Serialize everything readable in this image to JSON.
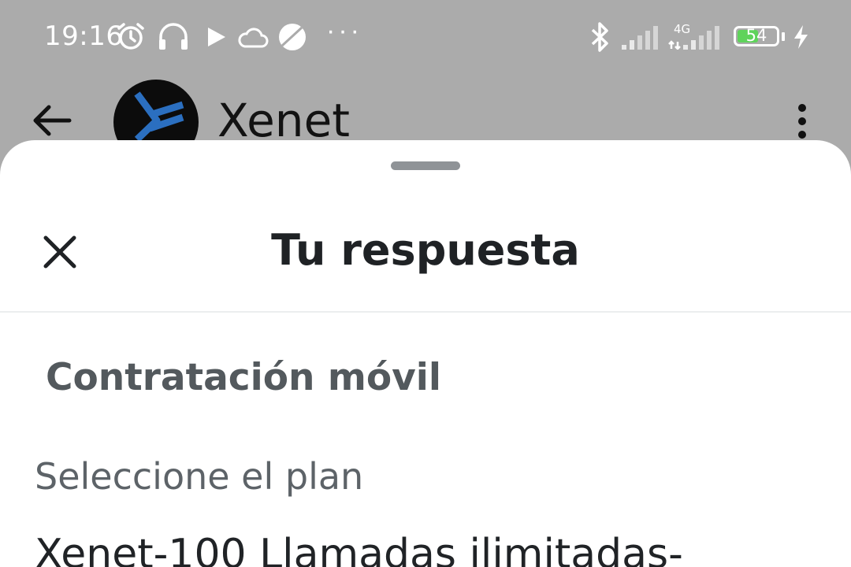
{
  "status_bar": {
    "time": "19:16",
    "notification_icons": [
      "alarm-icon",
      "headphones-icon",
      "play-icon",
      "cloud-icon",
      "planet-icon",
      "more-notifications-icon"
    ],
    "system_icons": [
      "bluetooth-icon",
      "signal-icon",
      "4g-signal-icon",
      "battery-icon",
      "charging-icon"
    ],
    "network_label": "4G",
    "battery_level": "54",
    "battery_fraction": 0.54,
    "battery_color": "#5fd35b"
  },
  "app_bar": {
    "title": "Xenet",
    "logo_color": "#2b6fc0"
  },
  "sheet": {
    "title": "Tu respuesta",
    "section_title": "Contratación móvil",
    "field_label": "Seleccione el plan",
    "first_option": "Xenet-100 Llamadas ilimitadas-"
  }
}
